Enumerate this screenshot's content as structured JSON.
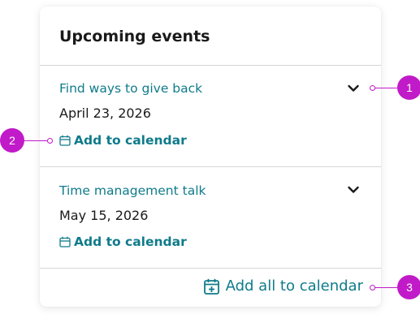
{
  "card": {
    "title": "Upcoming events",
    "events": [
      {
        "title": "Find ways to give back",
        "date": "April 23, 2026",
        "add_label": "Add to calendar"
      },
      {
        "title": "Time management talk",
        "date": "May 15, 2026",
        "add_label": "Add to calendar"
      }
    ],
    "add_all_label": "Add all to calendar"
  },
  "markers": [
    "1",
    "2",
    "3"
  ],
  "colors": {
    "accent": "#0f7b8a",
    "marker": "#c11ac8",
    "text": "#1a1a1a",
    "divider": "#d6d6d6"
  },
  "icons": {
    "expand": "chevron-down-icon",
    "add": "calendar-icon",
    "add_all": "calendar-plus-icon"
  }
}
